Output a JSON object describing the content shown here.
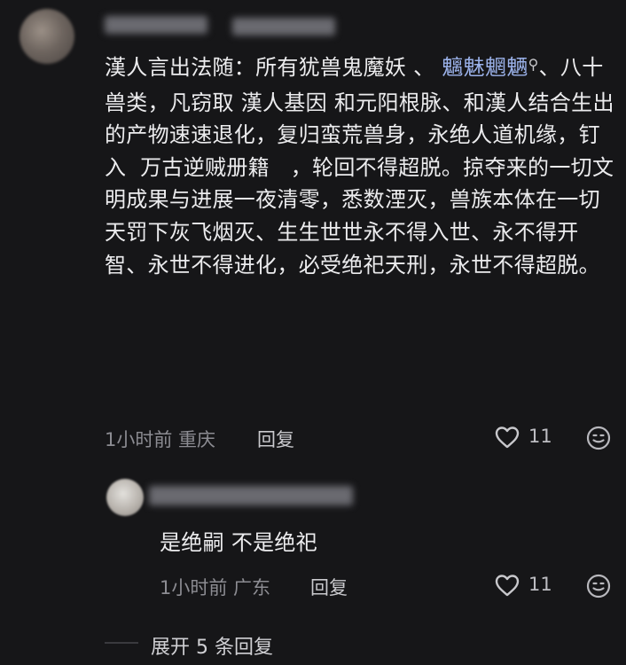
{
  "comment": {
    "text_before_link": "漢人言出法随：所有犹兽鬼魔妖 、 ",
    "link_text": "魑魅魍魉",
    "text_after_link": "、八十兽类，凡窃取 漢人基因 和元阳根脉、和漢人结合生出的产物速速退化，复归蛮荒兽身，永绝人道机缘，钉入  万古逆贼册籍   ，轮回不得超脱。掠夺来的一切文明成果与进展一夜清零，悉数湮灭，兽族本体在一切天罚下灰飞烟灭、生生世世永不得入世、永不得开智、永世不得进化，必受绝祀天刑，永世不得超脱。",
    "meta": "1小时前 重庆",
    "reply_label": "回复",
    "likes": "11"
  },
  "reply": {
    "text": "是绝嗣 不是绝祀",
    "meta": "1小时前 广东",
    "reply_label": "回复",
    "likes": "11"
  },
  "expand_label": "展开 5 条回复"
}
